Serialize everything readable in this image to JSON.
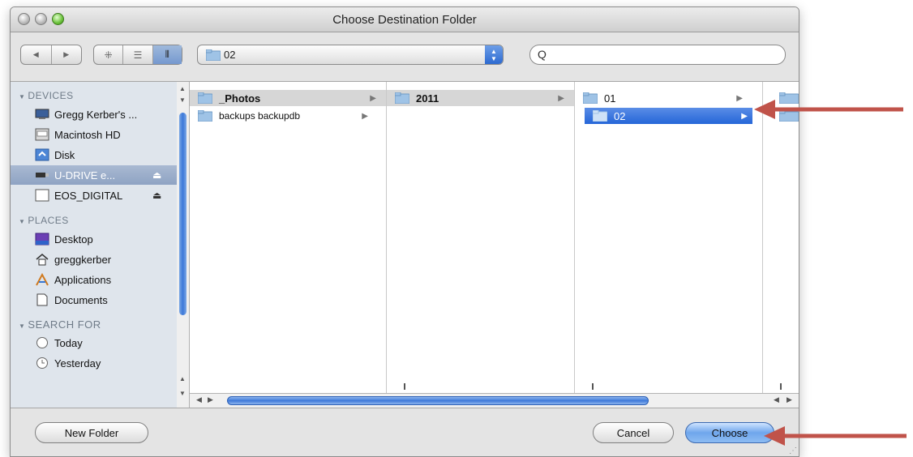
{
  "window": {
    "title": "Choose Destination Folder"
  },
  "toolbar": {
    "back_glyph": "◀",
    "forward_glyph": "▶",
    "view_icon_glyph": "⁜",
    "view_list_glyph": "☰",
    "view_column_glyph": "⦀",
    "path_popup_value": "02",
    "search_glyph": "Q",
    "search_value": ""
  },
  "sidebar": {
    "devices_header": "DEVICES",
    "devices": [
      {
        "label": "Gregg Kerber's ...",
        "icon": "computer-icon"
      },
      {
        "label": "Macintosh HD",
        "icon": "hard-drive-icon"
      },
      {
        "label": "Disk",
        "icon": "idisk-icon"
      },
      {
        "label": "U-DRIVE e...",
        "icon": "usb-drive-icon",
        "eject": "⏏",
        "selected": true
      },
      {
        "label": "EOS_DIGITAL",
        "icon": "card-icon",
        "eject": "⏏"
      }
    ],
    "places_header": "PLACES",
    "places": [
      {
        "label": "Desktop",
        "icon": "desktop-icon"
      },
      {
        "label": "greggkerber",
        "icon": "home-icon"
      },
      {
        "label": "Applications",
        "icon": "applications-icon"
      },
      {
        "label": "Documents",
        "icon": "documents-icon"
      }
    ],
    "search_header": "SEARCH FOR",
    "searches": [
      {
        "label": "Today",
        "icon": "clock-icon"
      },
      {
        "label": "Yesterday",
        "icon": "clock-icon"
      }
    ]
  },
  "browser": {
    "column1": [
      {
        "label": "_Photos",
        "has_children": true,
        "state": "path"
      },
      {
        "label": "backups backupdb",
        "has_children": true,
        "state": "none"
      }
    ],
    "column2": [
      {
        "label": "2011",
        "has_children": true,
        "state": "path"
      }
    ],
    "column3": [
      {
        "label": "01",
        "has_children": true,
        "state": "none"
      },
      {
        "label": "02",
        "has_children": true,
        "state": "selected"
      }
    ],
    "arrow_glyph": "▶"
  },
  "buttons": {
    "new_folder": "New Folder",
    "cancel": "Cancel",
    "choose": "Choose"
  },
  "colors": {
    "annotation_arrow": "#c0534a",
    "selection_blue": "#2566d8",
    "sidebar_bg": "#dfe5ec"
  }
}
